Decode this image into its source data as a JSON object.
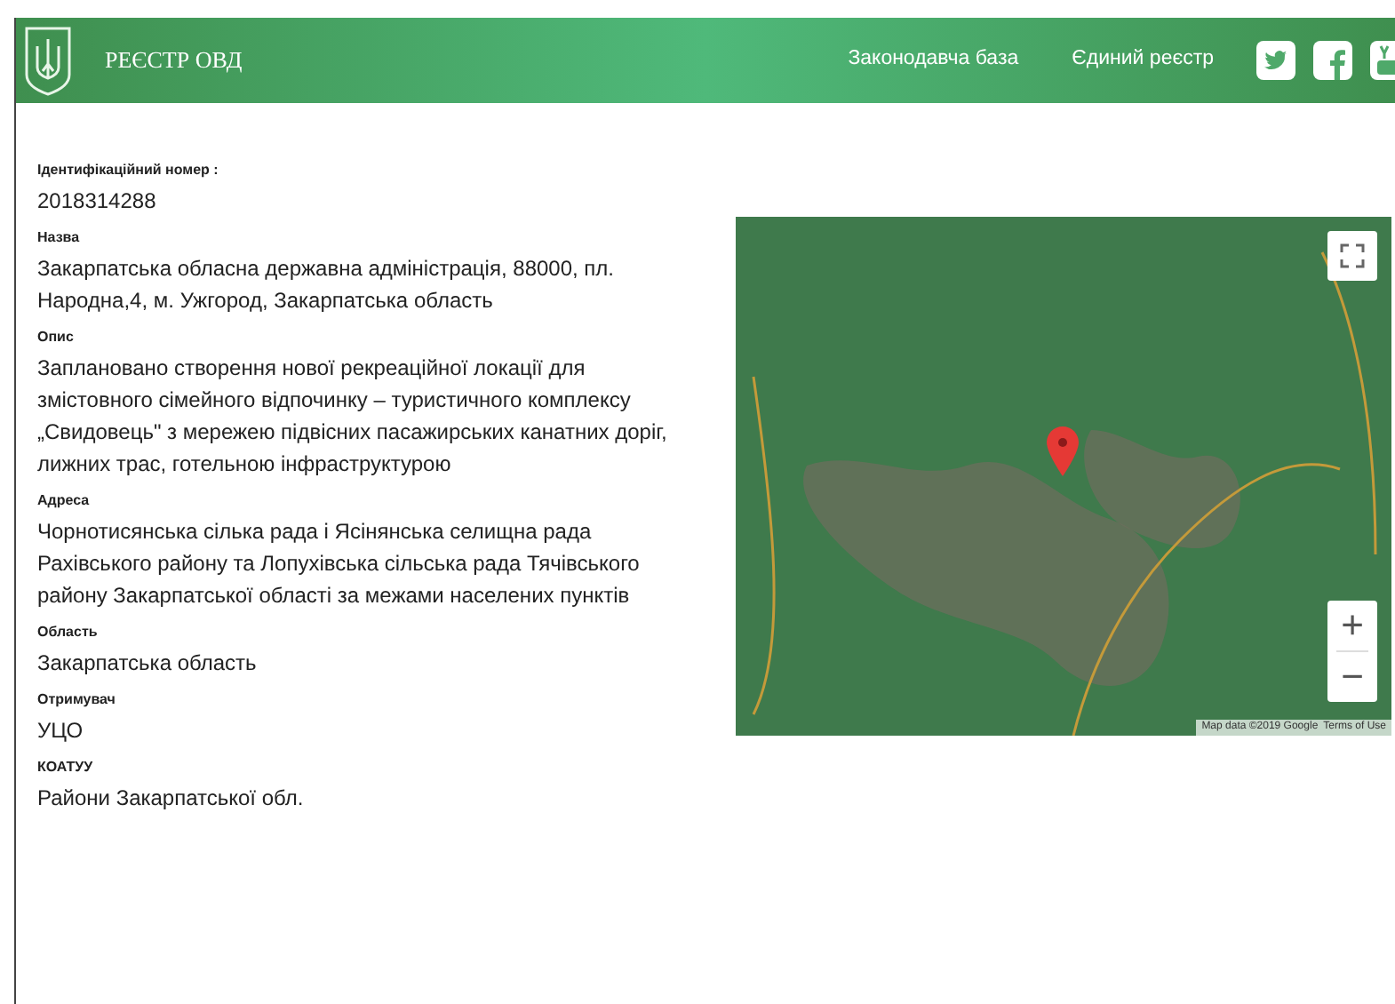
{
  "header": {
    "title": "РЕЄСТР ОВД",
    "nav": [
      {
        "label": "Законодавча база"
      },
      {
        "label": "Єдиний реєстр"
      }
    ],
    "social": [
      {
        "kind": "twitter"
      },
      {
        "kind": "facebook"
      },
      {
        "kind": "youtube"
      }
    ]
  },
  "fields": [
    {
      "label": "Ідентифікаційний номер :",
      "value": "2018314288"
    },
    {
      "label": "Назва",
      "value": "Закарпатська обласна державна адміністрація, 88000, пл. Народна,4, м. Ужгород, Закарпатська область"
    },
    {
      "label": "Опис",
      "value": "Заплановано створення нової рекреаційної локації для змістовного сімейного відпочинку – туристичного комплексу „Свидовець\" з мережею підвісних пасажирських канатних доріг, лижних трас, готельною інфраструктурою"
    },
    {
      "label": "Адреса",
      "value": "Чорнотисянська сілька рада і Ясінянська селищна рада Рахівського району та Лопухівська сільська рада Тячівського району Закарпатської області за межами населених пунктів"
    },
    {
      "label": "Область",
      "value": "Закарпатська область"
    },
    {
      "label": "Отримувач",
      "value": "УЦО"
    },
    {
      "label": "КОАТУУ",
      "value": "Райони Закарпатської обл."
    }
  ],
  "map": {
    "zoom_in": "+",
    "zoom_out": "−",
    "attribution": "Map data ©2019 Google",
    "terms": "Terms of Use"
  }
}
